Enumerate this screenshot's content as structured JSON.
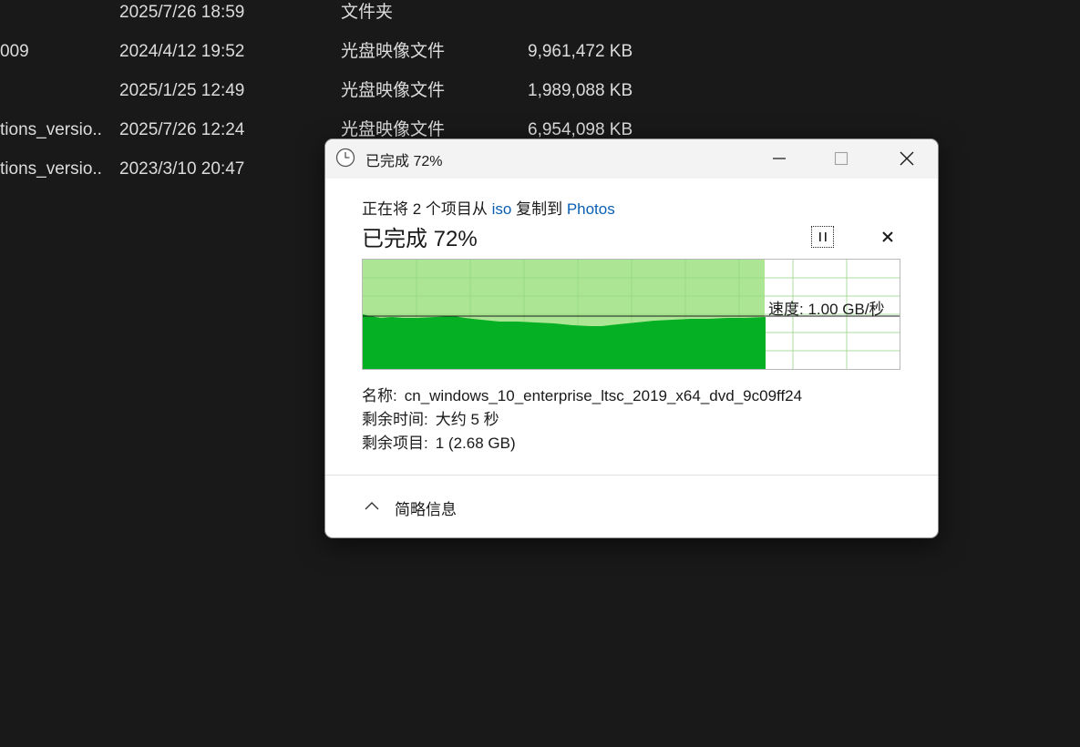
{
  "explorer": {
    "rows": [
      {
        "name": "",
        "date": "2025/7/26 18:59",
        "type": "文件夹",
        "size": ""
      },
      {
        "name": "009",
        "date": "2024/4/12 19:52",
        "type": "光盘映像文件",
        "size": "9,961,472 KB"
      },
      {
        "name": "",
        "date": "2025/1/25 12:49",
        "type": "光盘映像文件",
        "size": "1,989,088 KB"
      },
      {
        "name": "tions_versio...",
        "date": "2025/7/26 12:24",
        "type": "光盘映像文件",
        "size": "6,954,098 KB"
      },
      {
        "name": "tions_versio...",
        "date": "2023/3/10 20:47",
        "type": "",
        "size": ""
      }
    ]
  },
  "dialog": {
    "title": "已完成 72%",
    "desc_prefix": "正在将 2 个项目从 ",
    "source": "iso",
    "desc_middle": " 复制到 ",
    "destination": "Photos",
    "heading": "已完成 72%",
    "progress": 0.72,
    "speed": "速度: 1.00 GB/秒",
    "details": {
      "name_key": "名称:",
      "name_value": "cn_windows_10_enterprise_ltsc_2019_x64_dvd_9c09ff24",
      "time_key": "剩余时间:",
      "time_value": "大约 5 秒",
      "items_key": "剩余项目:",
      "items_value": "1 (2.68 GB)"
    },
    "toggle_label": "简略信息"
  },
  "colors": {
    "background": "#191919",
    "progress_fill": "#a8e58e",
    "throughput_fill": "#06b025",
    "link": "#0a5fb4"
  },
  "icons": {
    "title": "clock-icon",
    "minimize": "minimize-icon",
    "maximize": "maximize-icon",
    "close": "close-icon",
    "pause": "pause-icon",
    "cancel": "cancel-icon",
    "toggle": "chevron-up-icon"
  }
}
